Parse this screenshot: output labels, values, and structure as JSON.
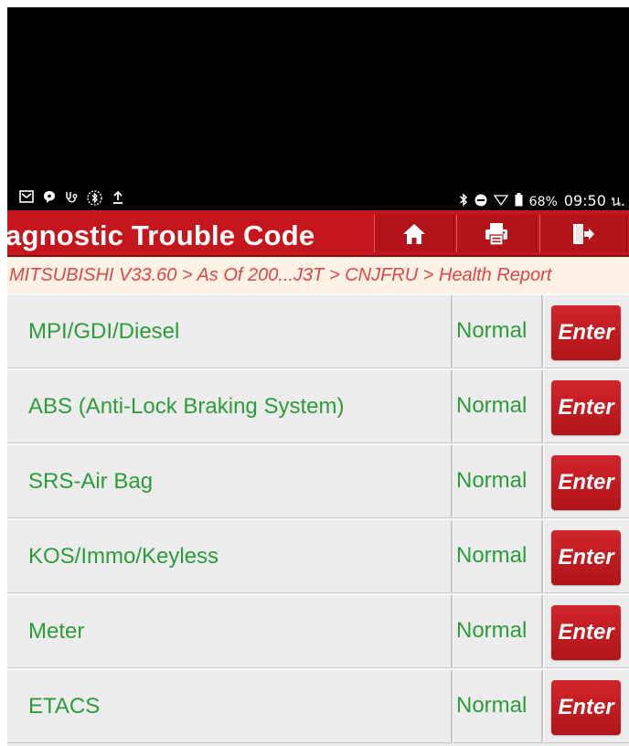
{
  "status_bar": {
    "left_icons": [
      "mail-icon",
      "chat-icon",
      "stethoscope-icon",
      "bluetooth-scan-icon",
      "upload-icon"
    ],
    "battery": "68%",
    "time": "09:50 น."
  },
  "header": {
    "title": "agnostic Trouble Code",
    "buttons": [
      "home-icon",
      "print-icon",
      "exit-icon"
    ]
  },
  "breadcrumb": "MITSUBISHI V33.60 > As Of 200...J3T > CNJFRU > Health Report",
  "systems": [
    {
      "name": "MPI/GDI/Diesel",
      "status": "Normal",
      "action": "Enter"
    },
    {
      "name": "ABS (Anti-Lock Braking System)",
      "status": "Normal",
      "action": "Enter"
    },
    {
      "name": "SRS-Air Bag",
      "status": "Normal",
      "action": "Enter"
    },
    {
      "name": "KOS/Immo/Keyless",
      "status": "Normal",
      "action": "Enter"
    },
    {
      "name": "Meter",
      "status": "Normal",
      "action": "Enter"
    },
    {
      "name": "ETACS",
      "status": "Normal",
      "action": "Enter"
    }
  ],
  "colors": {
    "header_bg": "#c4161c",
    "breadcrumb_bg": "#fdf2e4",
    "breadcrumb_text": "#e0454a",
    "system_text": "#2c9c3b",
    "enter_button": "#c8181f"
  }
}
